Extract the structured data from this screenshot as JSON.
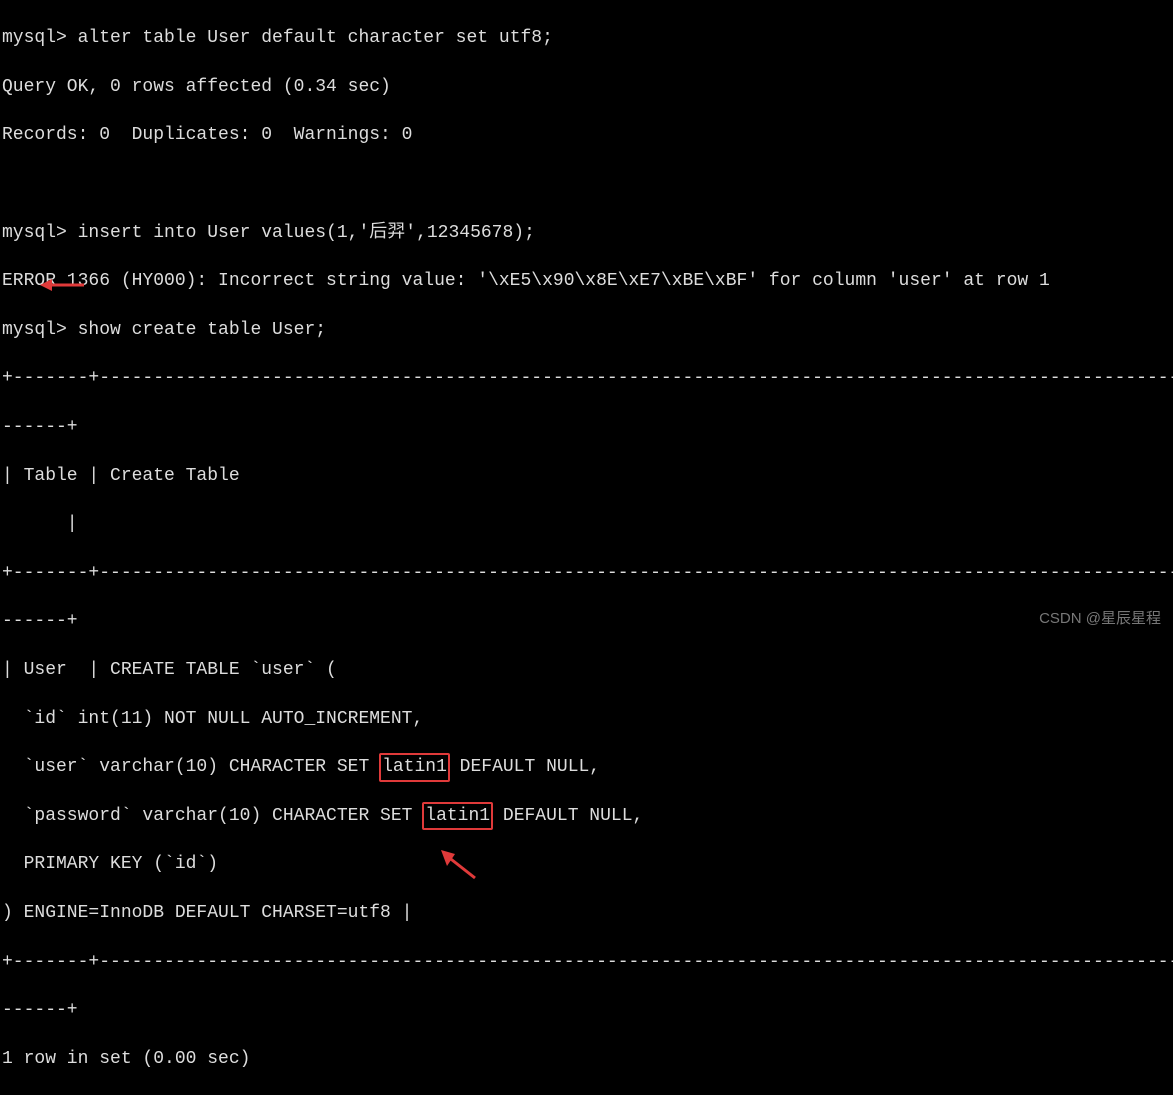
{
  "prompt": "mysql>",
  "lines": {
    "cmd1": "alter table User default character set utf8;",
    "res1a": "Query OK, 0 rows affected (0.34 sec)",
    "res1b": "Records: 0  Duplicates: 0  Warnings: 0",
    "cmd2": "insert into User values(1,'后羿',12345678);",
    "err": "ERROR 1366 (HY000): Incorrect string value: '\\xE5\\x90\\x8E\\xE7\\xBE\\xBF' for column 'user' at row 1",
    "cmd3": "show create table User;",
    "sep1": "+-------+-----------------------------------------------------------------------------------------------------------",
    "sep2": "------+",
    "header": "| Table | Create Table",
    "header_cont": "      |",
    "row_start": "| User  | CREATE TABLE `user` (",
    "row_id": "  `id` int(11) NOT NULL AUTO_INCREMENT,",
    "row_user_a": "  `user` varchar(10) CHARACTER SET ",
    "latin1": "latin1",
    "row_user_b": " DEFAULT NULL,",
    "row_pass_a": "  `password` varchar(10) CHARACTER SET ",
    "row_pass_b": " DEFAULT NULL,",
    "row_pk": "  PRIMARY KEY (`id`)",
    "row_end": ") ENGINE=InnoDB DEFAULT CHARSET=utf8 |",
    "footer": "1 row in set (0.00 sec)"
  },
  "watermark": "CSDN @星辰星程"
}
